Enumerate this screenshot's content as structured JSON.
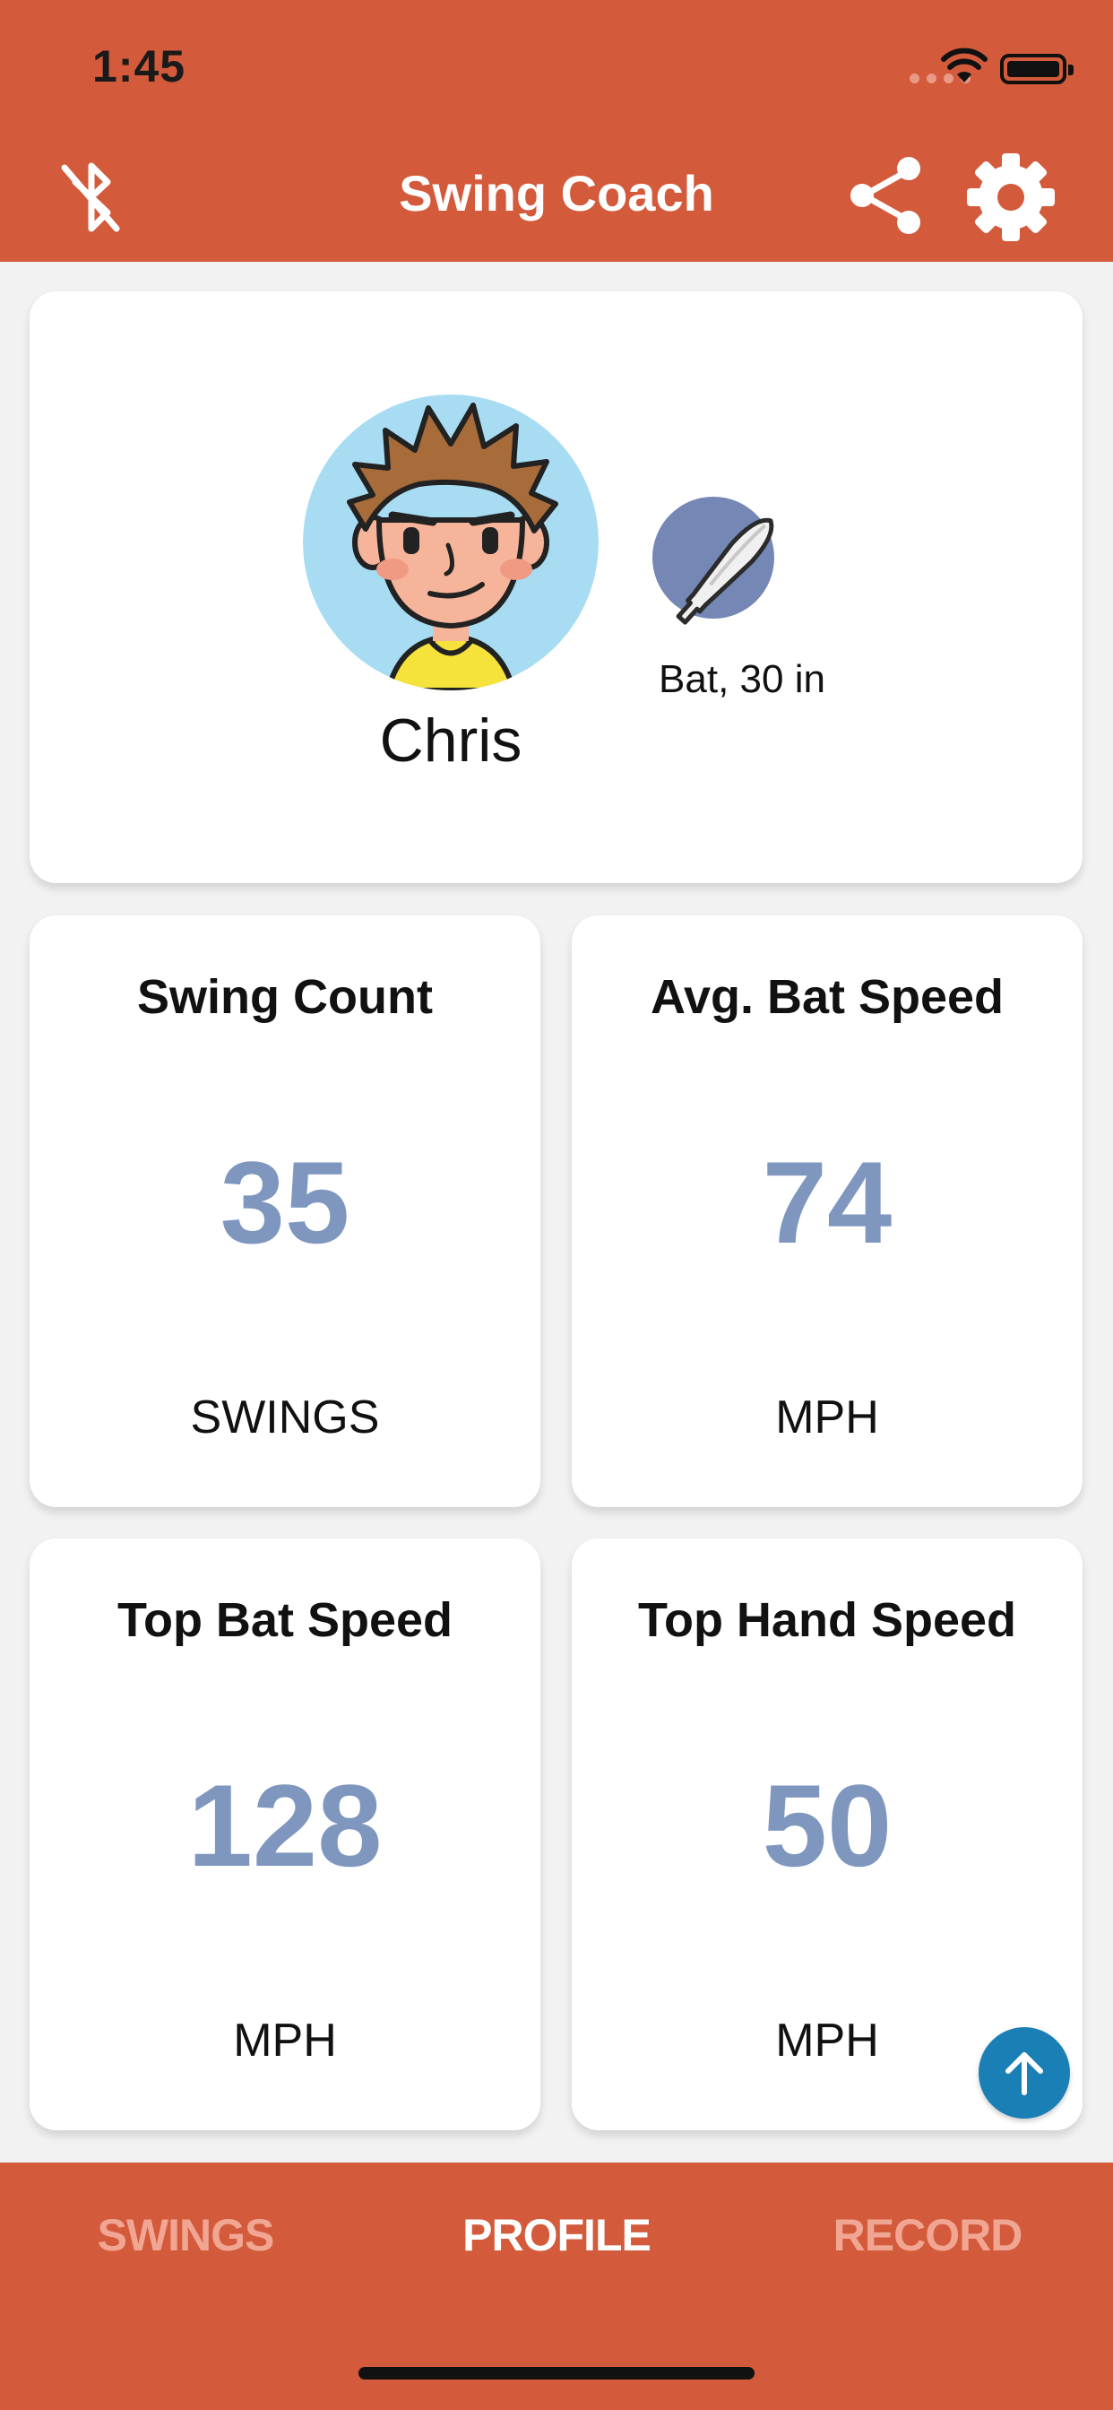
{
  "status_bar": {
    "time": "1:45"
  },
  "header": {
    "title": "Swing Coach",
    "icons": [
      "bluetooth-disabled-icon",
      "share-icon",
      "gear-icon"
    ],
    "background_color": "#d35a3b"
  },
  "profile": {
    "name": "Chris",
    "bat_label": "Bat, 30 in",
    "avatar": "avatar-icon",
    "bat_icon": "baseball-bat-icon"
  },
  "stats": [
    {
      "title": "Swing Count",
      "value": "35",
      "unit": "SWINGS"
    },
    {
      "title": "Avg. Bat Speed",
      "value": "74",
      "unit": "MPH"
    },
    {
      "title": "Top Bat Speed",
      "value": "128",
      "unit": "MPH"
    },
    {
      "title": "Top Hand Speed",
      "value": "50",
      "unit": "MPH"
    }
  ],
  "tabs": [
    {
      "label": "SWINGS",
      "active": false
    },
    {
      "label": "PROFILE",
      "active": true
    },
    {
      "label": "RECORD",
      "active": false
    }
  ],
  "colors": {
    "accent": "#d35a3b",
    "value_color": "#7f97bf",
    "fab_color": "#1a7fb5"
  }
}
